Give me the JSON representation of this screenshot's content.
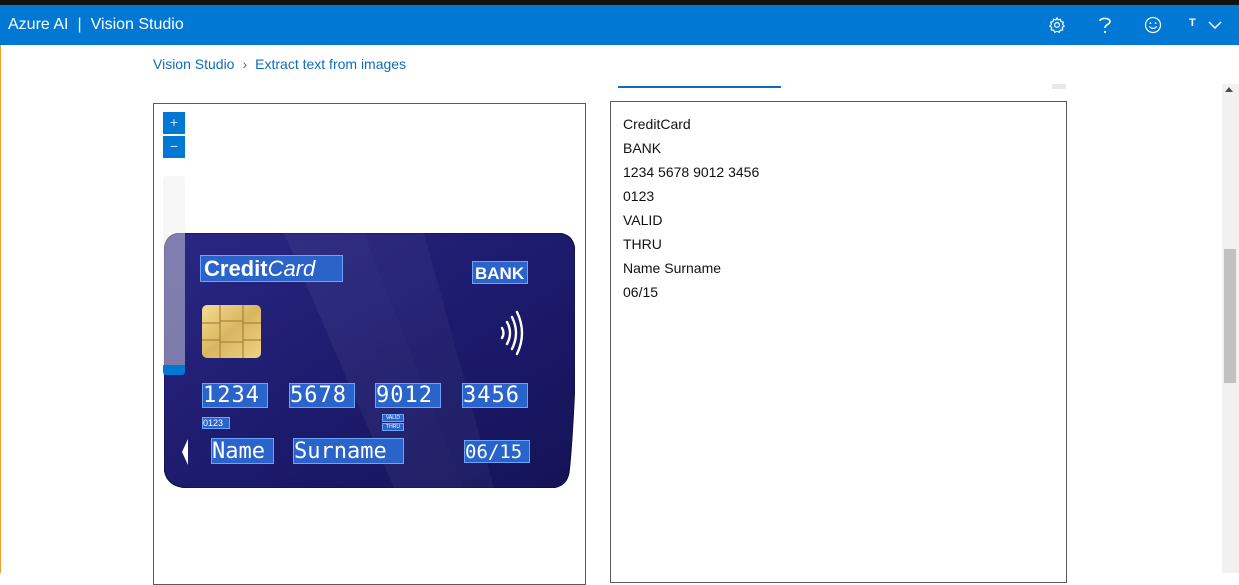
{
  "header": {
    "brand": "Azure AI",
    "separator": "|",
    "product": "Vision Studio",
    "user_initial": "T",
    "icons": [
      "gear-icon",
      "help-icon",
      "smiley-feedback-icon",
      "chevron-down-icon"
    ]
  },
  "breadcrumb": {
    "items": [
      "Vision Studio",
      "Extract text from images"
    ],
    "separator": "›"
  },
  "viewer": {
    "zoom_in": "+",
    "zoom_out": "−",
    "card_text": {
      "credit": "Credit",
      "card": "Card",
      "bank": "BANK",
      "numbers": [
        "1234",
        "5678",
        "9012",
        "3456"
      ],
      "code": "0123",
      "valid": "VALID",
      "thru": "THRU",
      "name": "Name",
      "surname": "Surname",
      "expiry": "06/15"
    }
  },
  "results": {
    "lines": [
      "CreditCard",
      "BANK",
      "1234 5678 9012 3456",
      "0123",
      "VALID",
      "THRU",
      "Name Surname",
      "06/15"
    ]
  },
  "colors": {
    "header_bg": "#0078d4",
    "link": "#0f6cbd",
    "card_bg": "#1d1a6e",
    "bbox": "#2a63c9"
  }
}
